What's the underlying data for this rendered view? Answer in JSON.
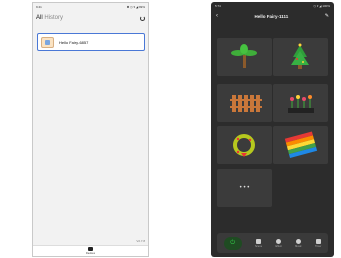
{
  "left_phone": {
    "status_time": "9:41",
    "status_icons": "✱ ◷ ▾ ◢ 99%",
    "title_all": "All",
    "title_history": "History",
    "device_item_label": "Hello Fairy-6857",
    "version": "V2.7.8",
    "bottom_tab_label": "Devices"
  },
  "right_phone": {
    "status_time": "5:74",
    "status_icons": "◷ ▾ ◢ 100%",
    "title": "Hello Fairy-1111",
    "back_glyph": "‹",
    "edit_glyph": "✎",
    "power_glyph": "⏻",
    "more_glyph": "• • •",
    "tiles": [
      "palm-tree",
      "christmas-tree",
      "fence",
      "tulips",
      "wreath",
      "rainbow-flag",
      "more"
    ],
    "nav_items": [
      "Scene",
      "Effect",
      "Music",
      "Timer"
    ]
  }
}
